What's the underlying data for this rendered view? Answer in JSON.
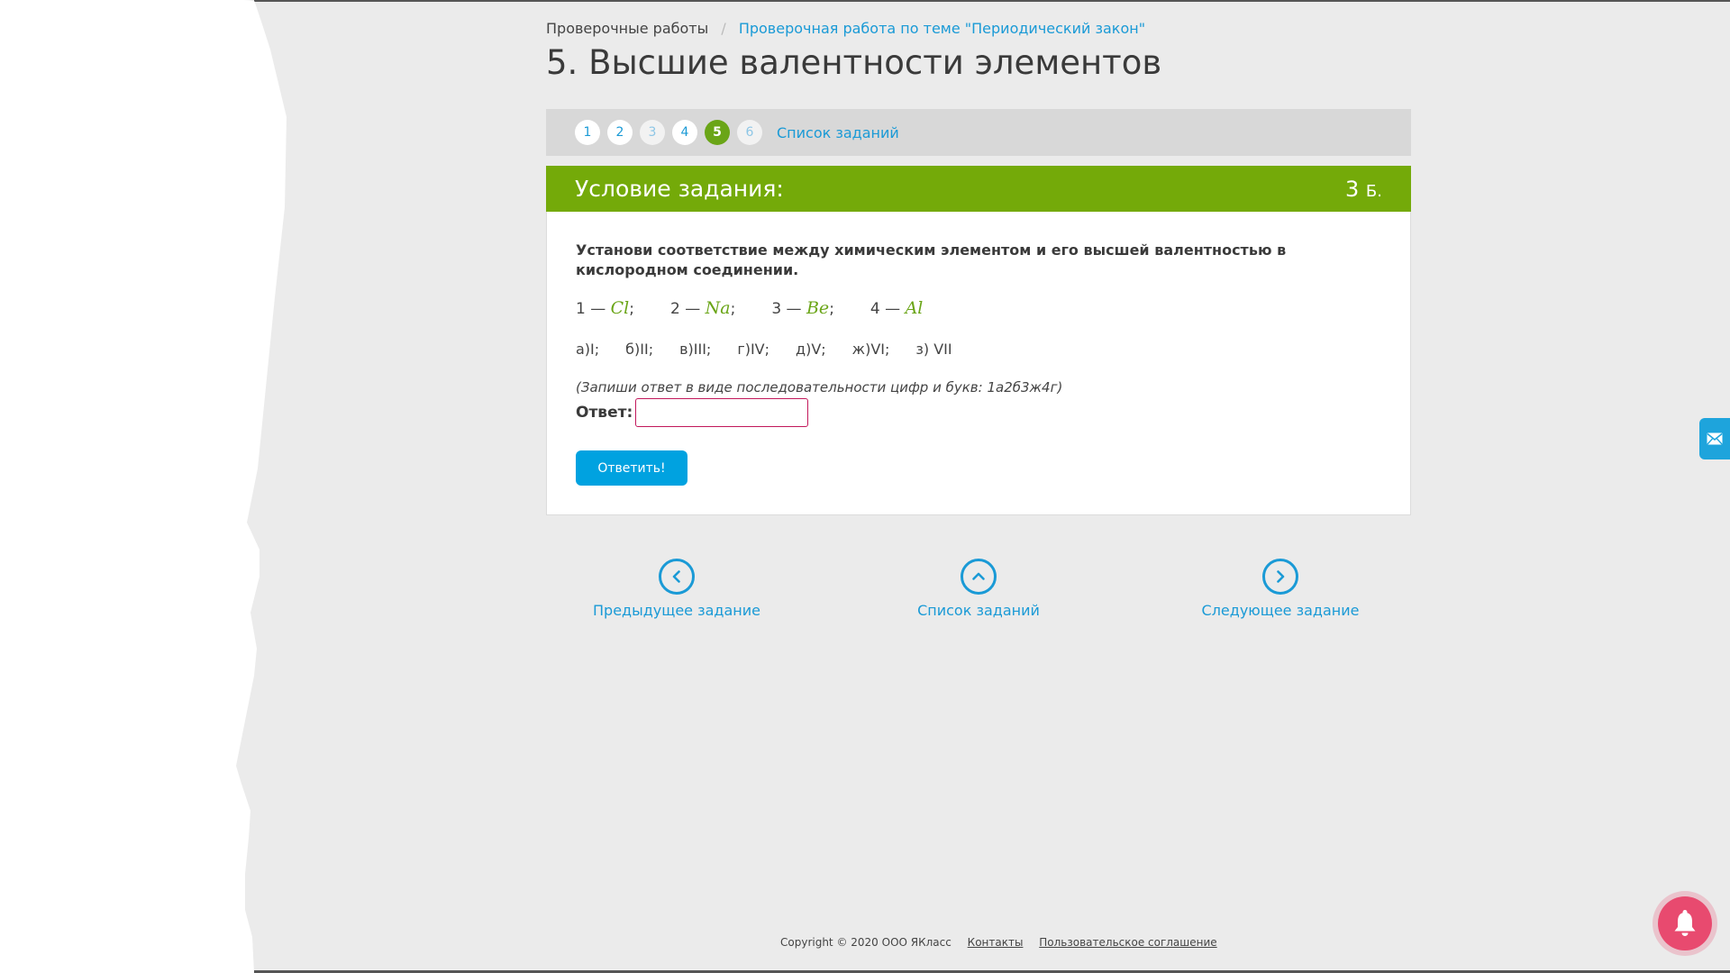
{
  "breadcrumb": {
    "root": "Проверочные работы",
    "separator": "/",
    "current": "Проверочная работа по теме \"Периодический закон\""
  },
  "page_title": "5. Высшие валентности элементов",
  "task_nav": {
    "steps": [
      "1",
      "2",
      "3",
      "4",
      "5",
      "6"
    ],
    "active_step": "5",
    "list_link": "Список заданий"
  },
  "condition": {
    "title": "Условие задания:",
    "points_value": "3",
    "points_unit": "Б."
  },
  "task": {
    "text": "Установи соответствие между химическим элементом и его высшей валентностью в кислородном соединении.",
    "elements": [
      {
        "num": "1 —",
        "symbol": "Cl",
        "punct": ";"
      },
      {
        "num": "2 —",
        "symbol": "Na",
        "punct": ";"
      },
      {
        "num": "3 —",
        "symbol": "Be",
        "punct": ";"
      },
      {
        "num": "4 —",
        "symbol": "Al",
        "punct": ""
      }
    ],
    "options": [
      "а)I;",
      "б)II;",
      "в)III;",
      "г)IV;",
      "д)V;",
      "ж)VI;",
      "з) VII"
    ],
    "hint": "(Запиши ответ в виде последовательности цифр и букв: 1а2б3ж4г)",
    "answer_label": "Ответ:",
    "answer_value": "",
    "submit_label": "Ответить!"
  },
  "bottom_nav": {
    "prev": "Предыдущее задание",
    "list": "Список заданий",
    "next": "Следующее задание"
  },
  "footer": {
    "copyright": "Copyright © 2020 ООО ЯКласс",
    "contacts": "Контакты",
    "agreement": "Пользовательское соглашение"
  },
  "colors": {
    "accent_green": "#74aa09",
    "link_blue": "#1a9ad6",
    "button_blue": "#00a2e0",
    "bell_pink": "#e84a6f"
  },
  "icons": {
    "prev": "chevron-left-circle-icon",
    "list": "chevron-up-circle-icon",
    "next": "chevron-right-circle-icon",
    "feedback": "mail-icon",
    "notifications": "bell-icon"
  }
}
